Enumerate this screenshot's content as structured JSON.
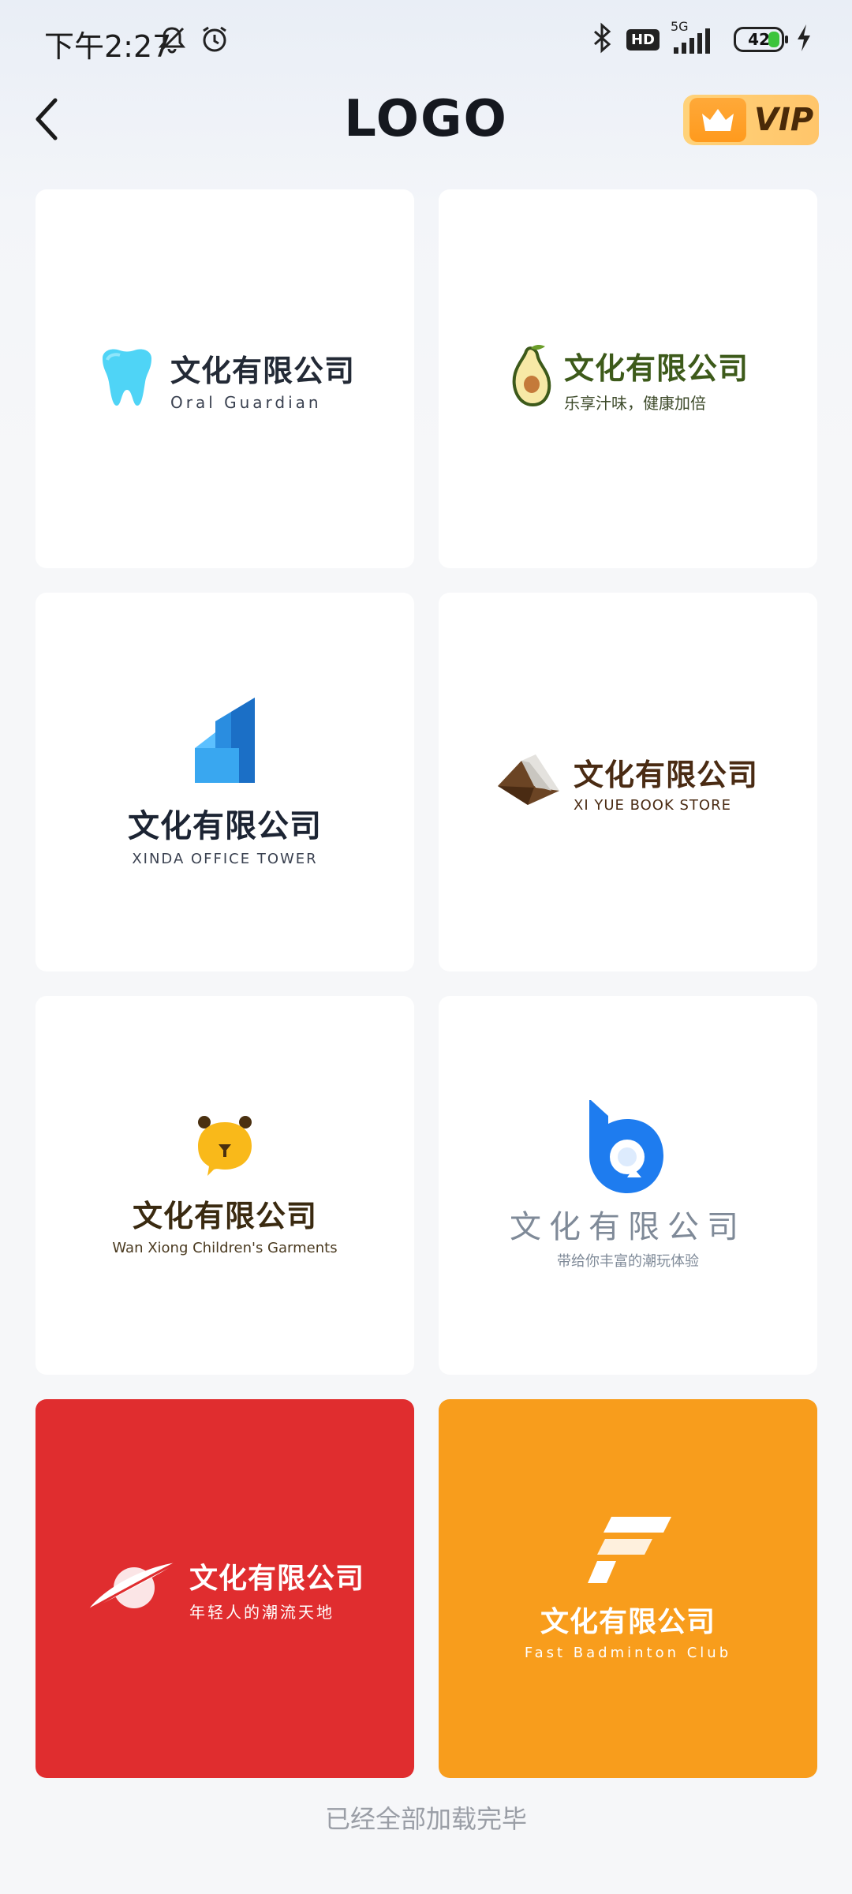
{
  "status_bar": {
    "time": "下午2:27",
    "network": "5G",
    "hd": "HD",
    "battery": "42"
  },
  "header": {
    "title": "LOGO",
    "vip_label": "VIP"
  },
  "logos": [
    {
      "title": "文化有限公司",
      "subtitle": "Oral Guardian"
    },
    {
      "title": "文化有限公司",
      "subtitle": "乐享汁味，健康加倍"
    },
    {
      "title": "文化有限公司",
      "subtitle": "XINDA OFFICE TOWER"
    },
    {
      "title": "文化有限公司",
      "subtitle": "XI YUE BOOK STORE"
    },
    {
      "title": "文化有限公司",
      "subtitle": "Wan Xiong Children's Garments"
    },
    {
      "title": "文化有限公司",
      "subtitle": "带给你丰富的潮玩体验"
    },
    {
      "title": "文化有限公司",
      "subtitle": "年轻人的潮流天地"
    },
    {
      "title": "文化有限公司",
      "subtitle": "Fast Badminton Club"
    }
  ],
  "footer": {
    "message": "已经全部加载完毕"
  },
  "colors": {
    "card_red": "#e02d2f",
    "card_orange": "#f89d1c",
    "vip_gold": "#ffc56a"
  }
}
